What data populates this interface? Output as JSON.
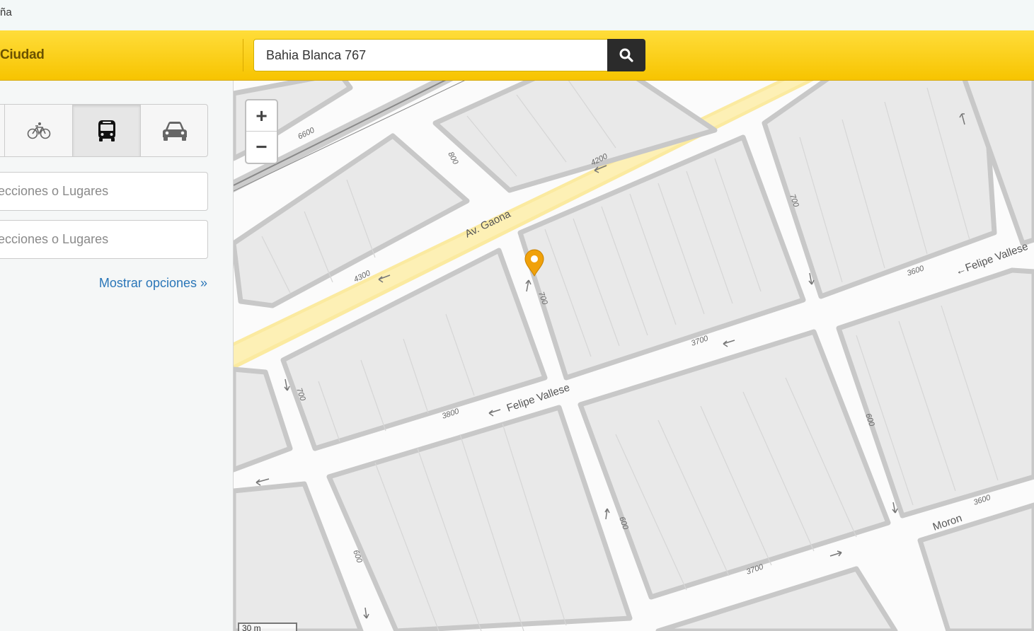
{
  "browser": {
    "title_fragment": "ña"
  },
  "header": {
    "brand": "Ciudad",
    "search_value": "Bahia Blanca 767"
  },
  "sidebar": {
    "transport_modes": [
      {
        "name": "walk",
        "icon": "walk-icon"
      },
      {
        "name": "bike",
        "icon": "bicycle-icon"
      },
      {
        "name": "transit",
        "icon": "bus-icon",
        "selected": true
      },
      {
        "name": "car",
        "icon": "car-icon"
      }
    ],
    "origin_placeholder": "ecciones o Lugares",
    "destination_placeholder": "ecciones o Lugares",
    "options_link": "Mostrar opciones »"
  },
  "map": {
    "zoom_in": "+",
    "zoom_out": "−",
    "scale_label": "30 m",
    "marker_color": "#f0a10a",
    "street_labels": {
      "gaona": "Av. Gaona",
      "vallese_upper": "←Felipe Vallese",
      "vallese_lower": "Felipe Vallese",
      "moron": "Moron"
    },
    "address_numbers": {
      "n6600": "6600",
      "n800": "800",
      "n4200": "4200",
      "n4300": "4300",
      "n700a": "700",
      "n700b": "700",
      "n700c": "700",
      "n3600a": "3600",
      "n3700a": "3700",
      "n3800": "3800",
      "n600a": "600",
      "n600b": "600",
      "n600c": "600",
      "n3600b": "3600",
      "n3700b": "3700"
    }
  }
}
